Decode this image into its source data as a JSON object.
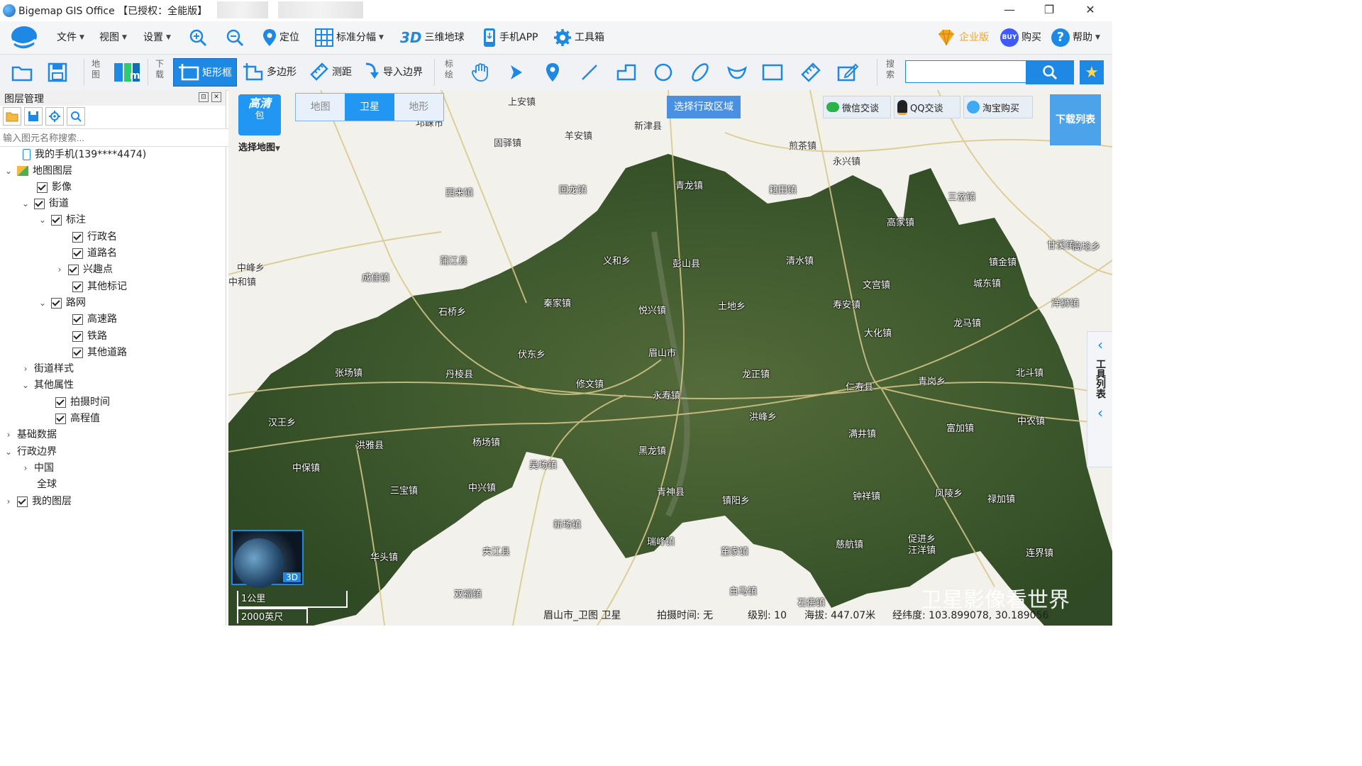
{
  "window": {
    "title": "Bigemap GIS Office 【已授权：全能版】",
    "controls": {
      "minimize": "—",
      "restore": "❐",
      "close": "✕"
    }
  },
  "menubar": {
    "file": "文件",
    "view": "视图",
    "settings": "设置",
    "locate": "定位",
    "standard_grid": "标准分幅",
    "globe_3d_badge": "3D",
    "globe_3d": "三维地球",
    "mobile_app": "手机APP",
    "toolbox": "工具箱",
    "enterprise": "企业版",
    "buy_badge": "BUY",
    "buy": "购买",
    "help": "帮助"
  },
  "toolbar": {
    "map_group_label": "地图",
    "download_group_label": "下载",
    "rect_frame": "矩形框",
    "polygon": "多边形",
    "measure": "测距",
    "import_boundary": "导入边界",
    "draw_group_label": "标绘",
    "search_group_label": "搜索",
    "search_placeholder": ""
  },
  "layer_panel": {
    "title": "图层管理",
    "search_placeholder": "输入图元名称搜索...",
    "tree": [
      {
        "label": "我的手机(139****4474)"
      },
      {
        "label": "地图图层"
      },
      {
        "label": "影像"
      },
      {
        "label": "街道"
      },
      {
        "label": "标注"
      },
      {
        "label": "行政名"
      },
      {
        "label": "道路名"
      },
      {
        "label": "兴趣点"
      },
      {
        "label": "其他标记"
      },
      {
        "label": "路网"
      },
      {
        "label": "高速路"
      },
      {
        "label": "铁路"
      },
      {
        "label": "其他道路"
      },
      {
        "label": "街道样式"
      },
      {
        "label": "其他属性"
      },
      {
        "label": "拍摄时间"
      },
      {
        "label": "高程值"
      },
      {
        "label": "基础数据"
      },
      {
        "label": "行政边界"
      },
      {
        "label": "中国"
      },
      {
        "label": "全球"
      },
      {
        "label": "我的图层"
      }
    ]
  },
  "map": {
    "map_pack_line1": "高清",
    "map_pack_line2": "包",
    "select_map": "选择地图",
    "tabs": {
      "map": "地图",
      "satellite": "卫星",
      "terrain": "地形"
    },
    "select_region": "选择行政区域",
    "wechat": "微信交谈",
    "qq": "QQ交谈",
    "taobao": "淘宝购买",
    "download_list": "下载列表",
    "tool_list": "工具列表",
    "minimap_badge": "3D",
    "scale_km": "1公里",
    "scale_ft": "2000英尺",
    "watermark": "卫星影像看世界",
    "labels": [
      {
        "t": "上安镇"
      },
      {
        "t": "新津县"
      },
      {
        "t": "邛崃市"
      },
      {
        "t": "固驿镇"
      },
      {
        "t": "羊安镇"
      },
      {
        "t": "煎茶镇"
      },
      {
        "t": "永兴镇"
      },
      {
        "t": "西来镇"
      },
      {
        "t": "回龙镇"
      },
      {
        "t": "青龙镇"
      },
      {
        "t": "籍田镇"
      },
      {
        "t": "三岔镇"
      },
      {
        "t": "高家镇"
      },
      {
        "t": "甘溪镇"
      },
      {
        "t": "镇金镇"
      },
      {
        "t": "中峰乡"
      },
      {
        "t": "蒲江县"
      },
      {
        "t": "成佳镇"
      },
      {
        "t": "义和乡"
      },
      {
        "t": "彭山县"
      },
      {
        "t": "清水镇"
      },
      {
        "t": "寿安镇"
      },
      {
        "t": "文宫镇"
      },
      {
        "t": "洋狮镇"
      },
      {
        "t": "石桥乡"
      },
      {
        "t": "秦家镇"
      },
      {
        "t": "悦兴镇"
      },
      {
        "t": "土地乡"
      },
      {
        "t": "大化镇"
      },
      {
        "t": "龙马镇"
      },
      {
        "t": "张场镇"
      },
      {
        "t": "伏东乡"
      },
      {
        "t": "眉山市"
      },
      {
        "t": "丹棱县"
      },
      {
        "t": "龙正镇"
      },
      {
        "t": "北斗镇"
      },
      {
        "t": "修文镇"
      },
      {
        "t": "永寿镇"
      },
      {
        "t": "仁寿县"
      },
      {
        "t": "青岗乡"
      },
      {
        "t": "汉王乡"
      },
      {
        "t": "洪峰乡"
      },
      {
        "t": "满井镇"
      },
      {
        "t": "富加镇"
      },
      {
        "t": "中农镇"
      },
      {
        "t": "洪雅县"
      },
      {
        "t": "杨场镇"
      },
      {
        "t": "黑龙镇"
      },
      {
        "t": "中保镇"
      },
      {
        "t": "吴场镇"
      },
      {
        "t": "三宝镇"
      },
      {
        "t": "中兴镇"
      },
      {
        "t": "青神县"
      },
      {
        "t": "钟祥镇"
      },
      {
        "t": "凤陵乡"
      },
      {
        "t": "禄加镇"
      },
      {
        "t": "镇阳乡"
      },
      {
        "t": "新场镇"
      },
      {
        "t": "瑞峰镇"
      },
      {
        "t": "促进乡"
      },
      {
        "t": "华头镇"
      },
      {
        "t": "夹江县"
      },
      {
        "t": "董家镇"
      },
      {
        "t": "慈航镇"
      },
      {
        "t": "汪洋镇"
      },
      {
        "t": "连界镇"
      },
      {
        "t": "双福镇"
      },
      {
        "t": "白马镇"
      },
      {
        "t": "石佛镇"
      },
      {
        "t": "高埝乡"
      },
      {
        "t": "中和镇"
      },
      {
        "t": "城东镇"
      }
    ]
  },
  "statusbar": {
    "map_name": "眉山市_卫图 卫星",
    "capture_time": "拍摄时间: 无",
    "level": "级别: 10",
    "altitude": "海拔: 447.07米",
    "lnglat": "经纬度: 103.899078, 30.189056"
  },
  "colors": {
    "accent_blue": "#1e88e5",
    "tab_active": "#2196f3",
    "region_button": "#4a90e2",
    "satellite_green": "#3b5a2e",
    "road_color": "#d8c88a"
  }
}
